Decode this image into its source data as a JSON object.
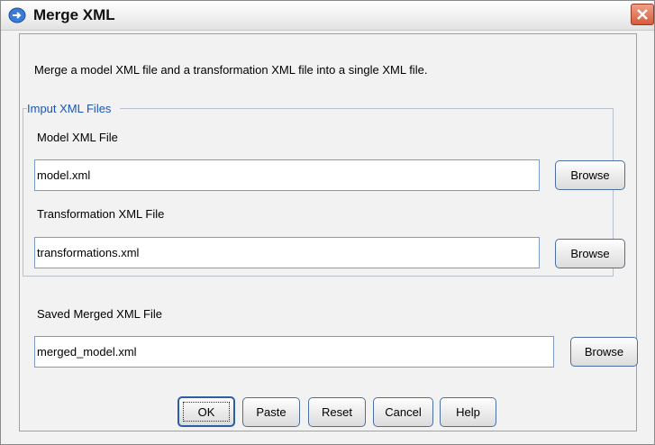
{
  "window": {
    "title": "Merge XML",
    "close_symbol": "×"
  },
  "description": "Merge a model XML file and a transformation XML file into a single XML file.",
  "input_group": {
    "legend": "Imput XML Files",
    "model_label": "Model XML File",
    "model_value": "model.xml",
    "transform_label": "Transformation XML File",
    "transform_value": "transformations.xml",
    "browse_label": "Browse"
  },
  "output": {
    "label": "Saved Merged XML File",
    "value": "merged_model.xml",
    "browse_label": "Browse"
  },
  "buttons": {
    "ok": "OK",
    "paste": "Paste",
    "reset": "Reset",
    "cancel": "Cancel",
    "help": "Help"
  },
  "colors": {
    "accent": "#2b5ea7",
    "legend_text": "#1a55b5",
    "close_red": "#d65a3c"
  }
}
